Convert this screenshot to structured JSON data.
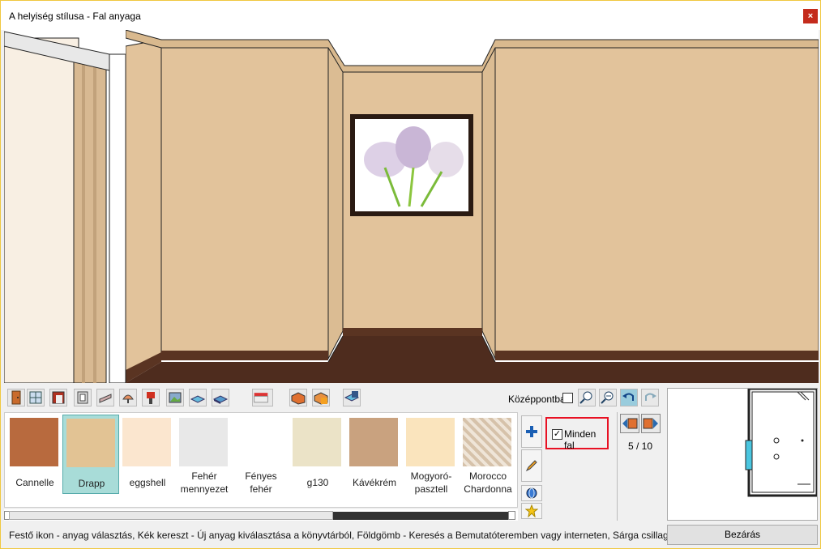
{
  "window": {
    "title": "A helyiség stílusa - Fal anyaga",
    "close_label": "×"
  },
  "toolbar": {
    "icons": [
      "door-icon",
      "window-icon",
      "frame-icon",
      "panel-icon",
      "skirting-icon",
      "lamp-icon",
      "paint-icon",
      "picture-icon",
      "floor-icon",
      "floor2-icon",
      "awning-icon",
      "wall-brick-icon",
      "wall-brick2-icon",
      "room-icon"
    ],
    "center_label": "Középpontba",
    "center_checked": false
  },
  "materials": [
    {
      "label": "Cannelle",
      "color": "#b86a3e"
    },
    {
      "label": "Drapp",
      "color": "#e2c394",
      "selected": true
    },
    {
      "label": "eggshell",
      "color": "#fbe6cf"
    },
    {
      "label": "Fehér mennyezet",
      "color": "#e8e8e8"
    },
    {
      "label": "Fényes fehér",
      "color": "#ffffff"
    },
    {
      "label": "g130",
      "color": "#ebe3c7"
    },
    {
      "label": "Kávékrém",
      "color": "#c9a27f"
    },
    {
      "label": "Mogyoró-pasztell",
      "color": "#fae4bd"
    },
    {
      "label": "Morocco Chardonna",
      "color": "#d6c2aa"
    }
  ],
  "side": {
    "all_walls_label": "Minden fal",
    "all_walls_checked": true,
    "page": "5 / 10"
  },
  "status": {
    "text": "Festő ikon - anyag választás, Kék kereszt - Új anyag kiválasztása a könyvtárból, Földgömb - Keresés a Bemutatóteremben vagy interneten, Sárga csillag - új anyag"
  },
  "close_button": {
    "label": "Bezárás"
  },
  "colors": {
    "wall": "#e2c39b",
    "floor": "#4e2c1e",
    "selected": "#a8dcd8",
    "highlight": "#e81123"
  }
}
